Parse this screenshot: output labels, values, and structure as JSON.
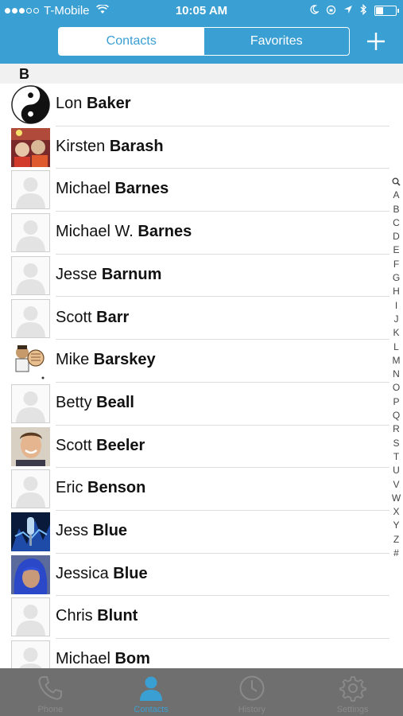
{
  "status_bar": {
    "carrier": "T-Mobile",
    "time": "10:05 AM"
  },
  "header": {
    "tabs": [
      {
        "label": "Contacts",
        "active": true
      },
      {
        "label": "Favorites",
        "active": false
      }
    ],
    "add_icon": "plus-icon"
  },
  "section": {
    "letter": "B"
  },
  "contacts": [
    {
      "first": "Lon",
      "last": "Baker",
      "avatar": "yin-yang"
    },
    {
      "first": "Kirsten",
      "last": "Barash",
      "avatar": "photo"
    },
    {
      "first": "Michael",
      "last": "Barnes",
      "avatar": "placeholder"
    },
    {
      "first": "Michael W.",
      "last": "Barnes",
      "avatar": "placeholder"
    },
    {
      "first": "Jesse",
      "last": "Barnum",
      "avatar": "placeholder"
    },
    {
      "first": "Scott",
      "last": "Barr",
      "avatar": "placeholder"
    },
    {
      "first": "Mike",
      "last": "Barskey",
      "avatar": "cartoon"
    },
    {
      "first": "Betty",
      "last": "Beall",
      "avatar": "placeholder"
    },
    {
      "first": "Scott",
      "last": "Beeler",
      "avatar": "photo"
    },
    {
      "first": "Eric",
      "last": "Benson",
      "avatar": "placeholder"
    },
    {
      "first": "Jess",
      "last": "Blue",
      "avatar": "photo"
    },
    {
      "first": "Jessica",
      "last": "Blue",
      "avatar": "photo"
    },
    {
      "first": "Chris",
      "last": "Blunt",
      "avatar": "placeholder"
    },
    {
      "first": "Michael",
      "last": "Bom",
      "avatar": "placeholder"
    }
  ],
  "index_letters": [
    "A",
    "B",
    "C",
    "D",
    "E",
    "F",
    "G",
    "H",
    "I",
    "J",
    "K",
    "L",
    "M",
    "N",
    "O",
    "P",
    "Q",
    "R",
    "S",
    "T",
    "U",
    "V",
    "W",
    "X",
    "Y",
    "Z",
    "#"
  ],
  "tab_bar": [
    {
      "label": "Phone",
      "icon": "phone-icon",
      "active": false
    },
    {
      "label": "Contacts",
      "icon": "person-icon",
      "active": true
    },
    {
      "label": "History",
      "icon": "clock-icon",
      "active": false
    },
    {
      "label": "Settings",
      "icon": "gear-icon",
      "active": false
    }
  ],
  "colors": {
    "accent": "#3a9fd2",
    "tab_bar": "#6f6f6f"
  }
}
